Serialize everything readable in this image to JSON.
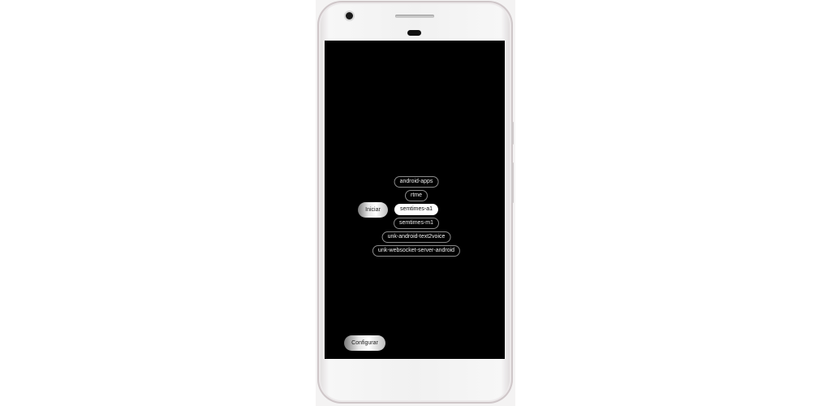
{
  "app": {
    "start_button_label": "Iniciar",
    "configure_button_label": "Configurar",
    "items": [
      {
        "label": "android-apps",
        "selected": false
      },
      {
        "label": "rtme",
        "selected": false
      },
      {
        "label": "semtimes-a1",
        "selected": true
      },
      {
        "label": "semtimes-m1",
        "selected": false
      },
      {
        "label": "unk-android-text2voice",
        "selected": false
      },
      {
        "label": "unk-websocket-server-android",
        "selected": false
      }
    ]
  },
  "colors": {
    "screen_background": "#000000",
    "chip_border": "#8a8a8a",
    "chip_text": "#f2f2f2",
    "selected_chip_background": "#ffffff",
    "selected_chip_text": "#000000"
  }
}
